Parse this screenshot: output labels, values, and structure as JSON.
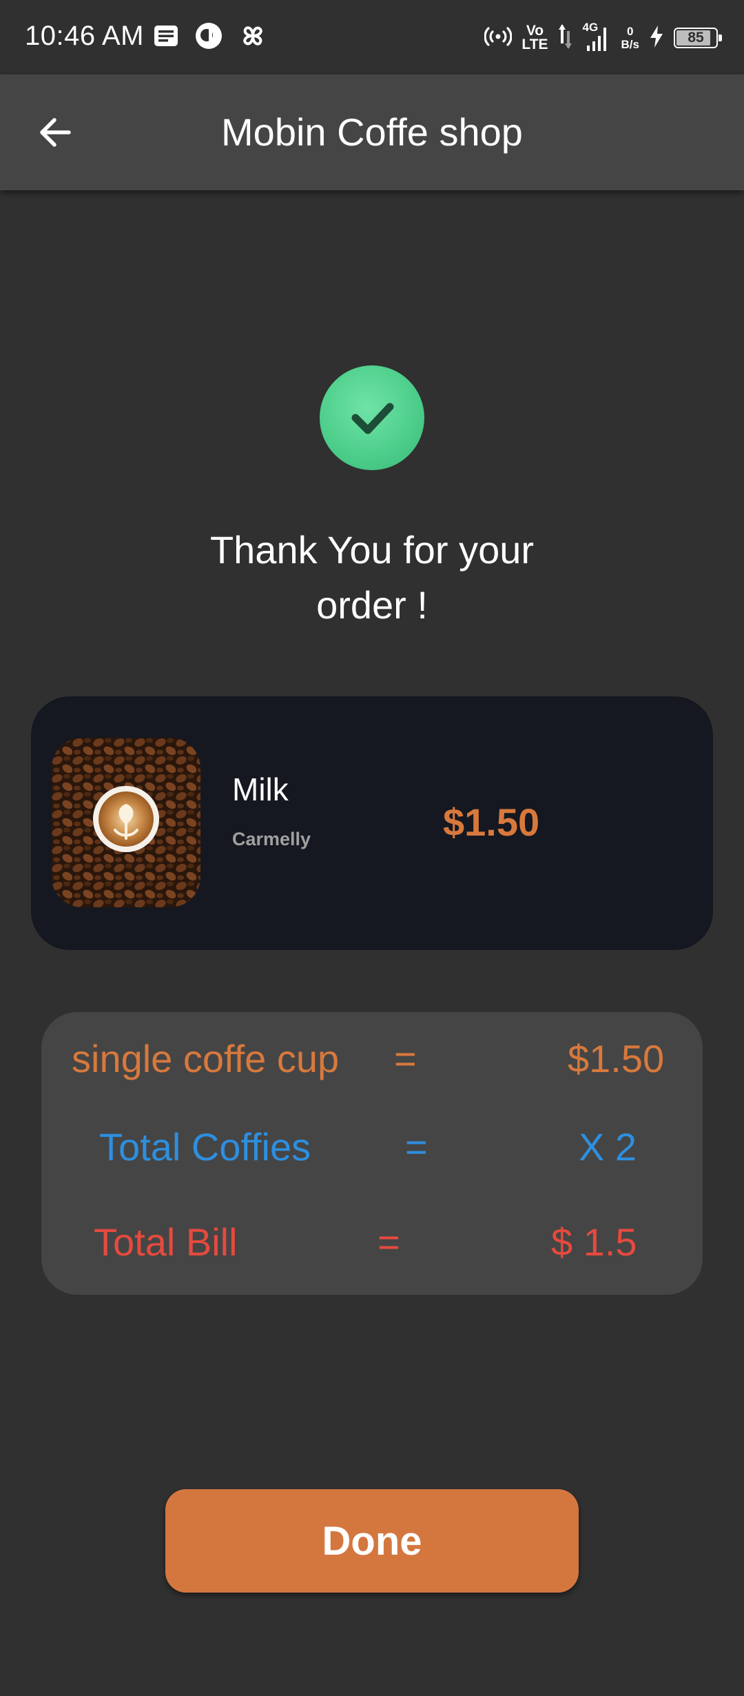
{
  "status_bar": {
    "time": "10:46 AM",
    "network_top": "Vo",
    "network_bottom": "LTE",
    "signal_type": "4G",
    "speed_value": "0",
    "speed_unit": "B/s",
    "battery": "85",
    "icons": [
      "notification-icon",
      "app-icon",
      "pinwheel-icon",
      "hotspot-icon",
      "data-transfer-icon",
      "signal-icon",
      "charging-icon",
      "battery-icon"
    ]
  },
  "app_bar": {
    "title": "Mobin Coffe shop",
    "back_icon": "arrow-back-icon"
  },
  "confirmation": {
    "icon": "check-icon",
    "line1": "Thank You for your",
    "line2": "order !",
    "check_color": "#4fcf8c"
  },
  "order_item": {
    "name": "Milk",
    "subtitle": "Carmelly",
    "price": "$1.50",
    "image": "coffee-latte-image"
  },
  "summary": {
    "rows": [
      {
        "label": "single coffe cup",
        "eq": "=",
        "value": "$1.50"
      },
      {
        "label": "Total Coffies",
        "eq": "=",
        "value": "X 2"
      },
      {
        "label": "Total Bill",
        "eq": "=",
        "value": "$ 1.5"
      }
    ]
  },
  "done_button": {
    "label": "Done"
  },
  "colors": {
    "background": "#303030",
    "app_bar": "#454545",
    "accent": "#d4773f",
    "card_dark": "#151820",
    "blue": "#2e8fdf",
    "red": "#e64a3e"
  }
}
